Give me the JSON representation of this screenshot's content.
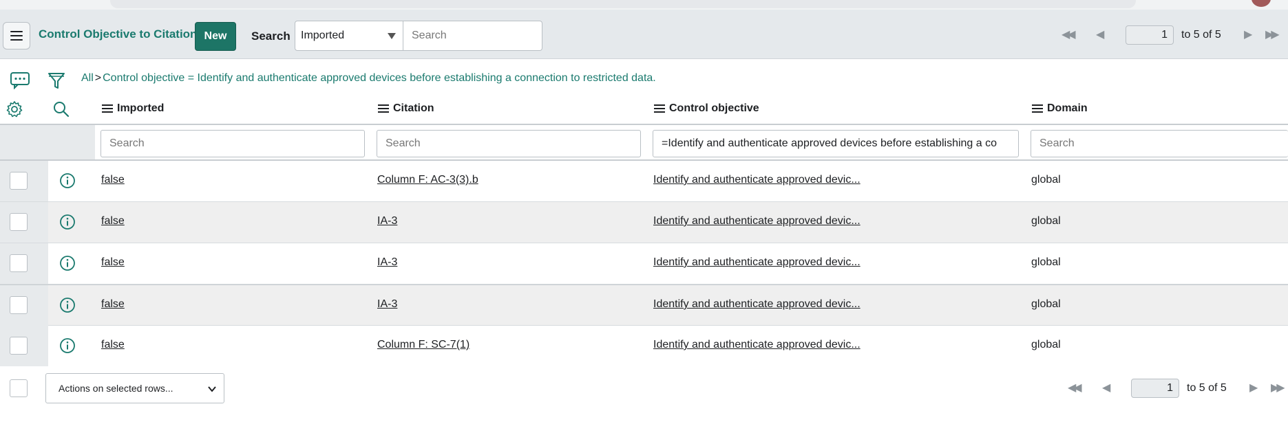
{
  "header": {
    "title": "Control Objective to Citations",
    "new_label": "New",
    "search_label": "Search",
    "search_field_selected": "Imported",
    "search_placeholder": "Search"
  },
  "pager_top": {
    "page": "1",
    "range": "to 5 of 5"
  },
  "breadcrumb": {
    "all": "All",
    "separator": ">",
    "filter": "Control objective = Identify and authenticate approved devices before establishing a connection to restricted data."
  },
  "columns": [
    {
      "label": "Imported",
      "search_placeholder": "Search",
      "search_value": ""
    },
    {
      "label": "Citation",
      "search_placeholder": "Search",
      "search_value": ""
    },
    {
      "label": "Control objective",
      "search_placeholder": "Search",
      "search_value": "=Identify and authenticate approved devices before establishing a co"
    },
    {
      "label": "Domain",
      "search_placeholder": "Search",
      "search_value": ""
    }
  ],
  "rows": [
    {
      "imported": "false",
      "citation": "Column F: AC-3(3).b",
      "control_objective": "Identify and authenticate approved devic...",
      "domain": "global"
    },
    {
      "imported": "false",
      "citation": "IA-3",
      "control_objective": "Identify and authenticate approved devic...",
      "domain": "global"
    },
    {
      "imported": "false",
      "citation": "IA-3",
      "control_objective": "Identify and authenticate approved devic...",
      "domain": "global"
    },
    {
      "imported": "false",
      "citation": "IA-3",
      "control_objective": "Identify and authenticate approved devic...",
      "domain": "global"
    },
    {
      "imported": "false",
      "citation": "Column F: SC-7(1)",
      "control_objective": "Identify and authenticate approved devic...",
      "domain": "global"
    }
  ],
  "footer": {
    "actions_label": "Actions on selected rows...",
    "page": "1",
    "range": "to 5 of 5"
  },
  "colors": {
    "accent": "#1a7a6e",
    "new_button": "#1d7566",
    "header_bg": "#e5e9ec"
  }
}
